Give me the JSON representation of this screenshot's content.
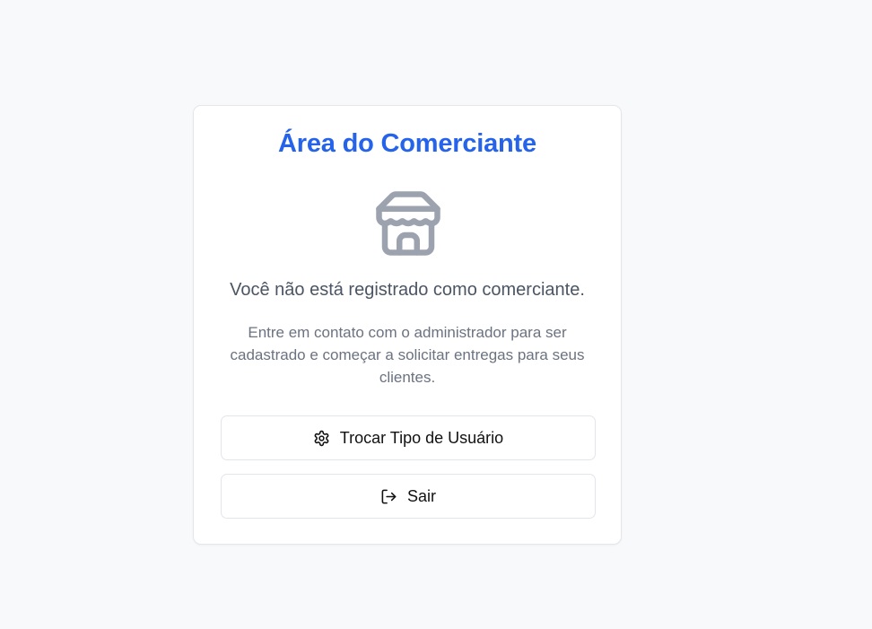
{
  "card": {
    "title": "Área do Comerciante",
    "icon": "store-icon",
    "message": "Você não está registrado como comerciante.",
    "description": "Entre em contato com o administrador para ser cadastrado e começar a solicitar entregas para seus clientes.",
    "buttons": {
      "switch_user_type": {
        "label": "Trocar Tipo de Usuário",
        "icon": "gear-icon"
      },
      "logout": {
        "label": "Sair",
        "icon": "logout-icon"
      }
    }
  },
  "colors": {
    "background": "#f8f9fb",
    "title": "#2563eb",
    "icon": "#9ca3af",
    "message": "#4b5563",
    "description": "#6b7280"
  }
}
